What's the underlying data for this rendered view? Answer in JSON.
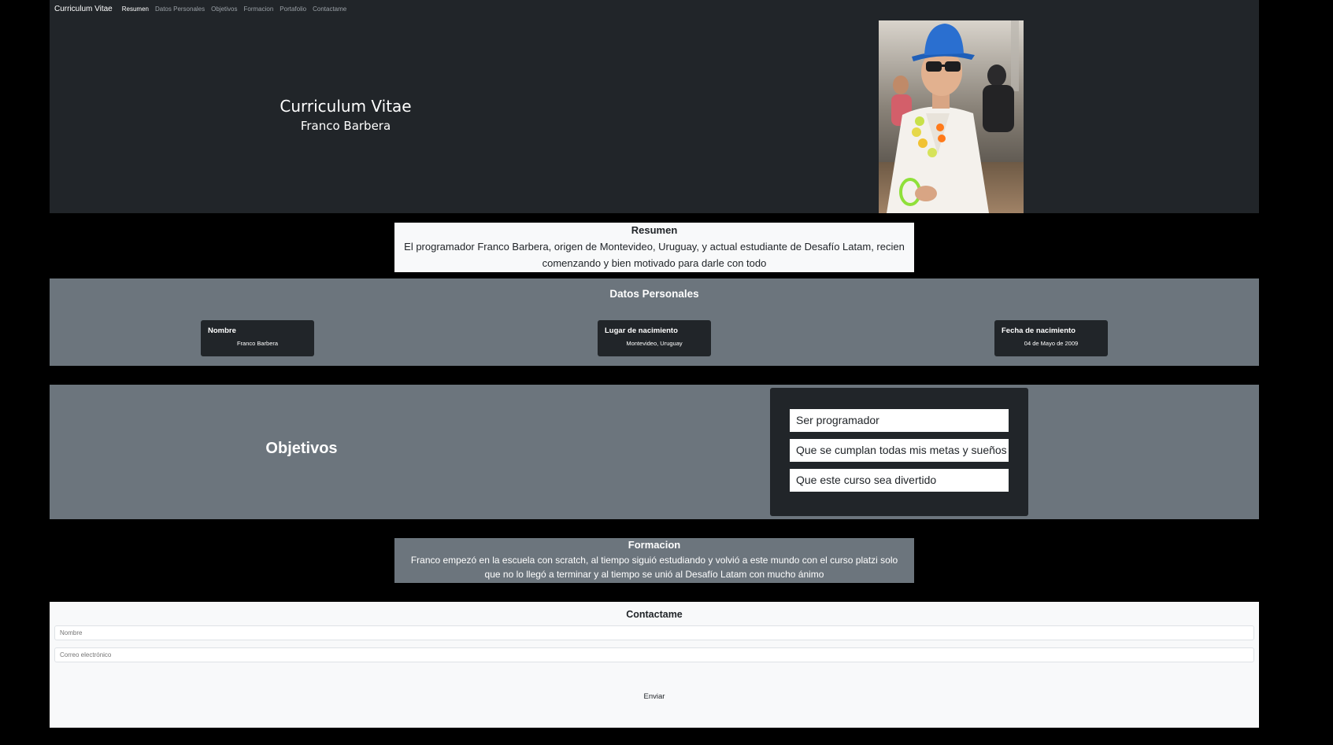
{
  "nav": {
    "brand": "Curriculum Vitae",
    "links": [
      "Resumen",
      "Datos Personales",
      "Objetivos",
      "Formacion",
      "Portafolio",
      "Contactame"
    ]
  },
  "hero": {
    "title": "Curriculum Vitae",
    "subtitle": "Franco Barbera"
  },
  "resumen": {
    "title": "Resumen",
    "text": "El programador Franco Barbera, origen de Montevideo, Uruguay, y actual estudiante de Desafío Latam, recien comenzando y bien motivado para darle con todo"
  },
  "datos": {
    "title": "Datos Personales",
    "cards": [
      {
        "label": "Nombre",
        "value": "Franco Barbera"
      },
      {
        "label": "Lugar de nacimiento",
        "value": "Montevideo, Uruguay"
      },
      {
        "label": "Fecha de nacimiento",
        "value": "04 de Mayo de 2009"
      }
    ]
  },
  "objetivos": {
    "title": "Objetivos",
    "items": [
      "Ser programador",
      "Que se cumplan todas mis metas y sueños",
      "Que este curso sea divertido"
    ]
  },
  "formacion": {
    "title": "Formacion",
    "text": "Franco empezó en la escuela con scratch, al tiempo siguió estudiando y volvió a este mundo con el curso platzi solo que no lo llegó a terminar y al tiempo se unió al Desafío Latam con mucho ánimo"
  },
  "contact": {
    "title": "Contactame",
    "name_placeholder": "Nombre",
    "email_placeholder": "Correo electrónico",
    "send_label": "Enviar"
  },
  "colors": {
    "dark": "#212529",
    "secondary": "#6c757d",
    "light": "#f8f9fa"
  }
}
